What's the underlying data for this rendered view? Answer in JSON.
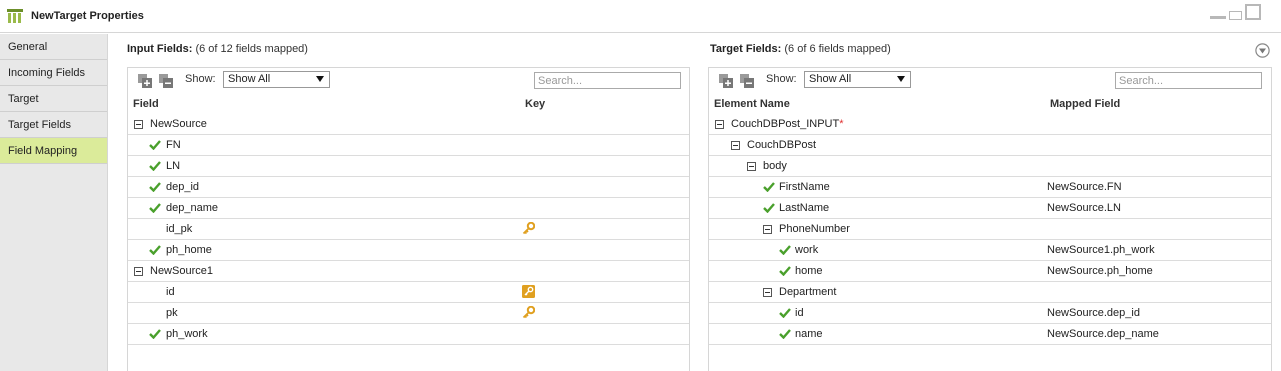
{
  "window": {
    "title": "NewTarget Properties"
  },
  "sidebar": {
    "items": [
      {
        "label": "General"
      },
      {
        "label": "Incoming Fields"
      },
      {
        "label": "Target"
      },
      {
        "label": "Target Fields"
      },
      {
        "label": "Field Mapping",
        "active": true
      }
    ]
  },
  "input_panel": {
    "title": "Input Fields:",
    "subtitle": "(6 of 12 fields mapped)",
    "show_label": "Show:",
    "show_value": "Show All",
    "search_placeholder": "Search...",
    "col_field": "Field",
    "col_key": "Key",
    "rows": [
      {
        "label": "NewSource",
        "type": "group"
      },
      {
        "label": "FN",
        "mapped": true
      },
      {
        "label": "LN",
        "mapped": true
      },
      {
        "label": "dep_id",
        "mapped": true
      },
      {
        "label": "dep_name",
        "mapped": true
      },
      {
        "label": "id_pk",
        "mapped": false,
        "key": "primary"
      },
      {
        "label": "ph_home",
        "mapped": true
      },
      {
        "label": "NewSource1",
        "type": "group"
      },
      {
        "label": "id",
        "mapped": false,
        "key": "foreign"
      },
      {
        "label": "pk",
        "mapped": false,
        "key": "primary"
      },
      {
        "label": "ph_work",
        "mapped": true
      }
    ]
  },
  "target_panel": {
    "title": "Target Fields:",
    "subtitle": "(6 of 6 fields mapped)",
    "show_label": "Show:",
    "show_value": "Show All",
    "search_placeholder": "Search...",
    "col_element": "Element Name",
    "col_mapped": "Mapped Field",
    "rows": [
      {
        "label": "CouchDBPost_INPUT",
        "required": "*",
        "type": "group",
        "level": 0,
        "mapped_field": ""
      },
      {
        "label": "CouchDBPost",
        "type": "group",
        "level": 1,
        "mapped_field": ""
      },
      {
        "label": "body",
        "type": "group",
        "level": 2,
        "mapped_field": ""
      },
      {
        "label": "FirstName",
        "mapped": true,
        "level": 3,
        "mapped_field": "NewSource.FN"
      },
      {
        "label": "LastName",
        "mapped": true,
        "level": 3,
        "mapped_field": "NewSource.LN"
      },
      {
        "label": "PhoneNumber",
        "type": "group",
        "level": 3,
        "mapped_field": ""
      },
      {
        "label": "work",
        "mapped": true,
        "level": 4,
        "mapped_field": "NewSource1.ph_work"
      },
      {
        "label": "home",
        "mapped": true,
        "level": 4,
        "mapped_field": "NewSource.ph_home"
      },
      {
        "label": "Department",
        "type": "group",
        "level": 3,
        "mapped_field": ""
      },
      {
        "label": "id",
        "mapped": true,
        "level": 4,
        "mapped_field": "NewSource.dep_id"
      },
      {
        "label": "name",
        "mapped": true,
        "level": 4,
        "mapped_field": "NewSource.dep_name"
      }
    ]
  },
  "colors": {
    "active_nav": "#dbeb9a",
    "check_green": "#4aa02c",
    "key_gold": "#e0a020",
    "required_red": "#e03030"
  }
}
